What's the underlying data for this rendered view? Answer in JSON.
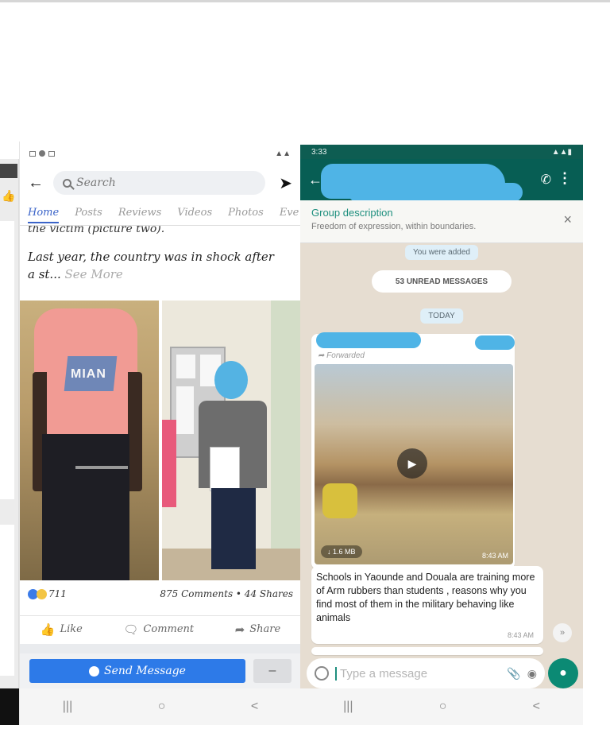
{
  "facebook": {
    "search_placeholder": "Search",
    "tabs": [
      "Home",
      "Posts",
      "Reviews",
      "Videos",
      "Photos",
      "Eve"
    ],
    "post_text_cut": "the victim (picture two).",
    "post_text": "Last year, the country was in shock after",
    "post_text_line2": "a st...",
    "see_more": "See More",
    "photo_print_text": "MIAN",
    "reaction_count": "711",
    "comments_shares": "875 Comments • 44 Shares",
    "actions": {
      "like": "Like",
      "comment": "Comment",
      "share": "Share"
    },
    "send_message": "Send Message",
    "more_button": "–"
  },
  "whatsapp": {
    "status_time": "3:33",
    "group_description_title": "Group description",
    "group_description_text": "Freedom of expression, within boundaries.",
    "you_were_added": "You were added",
    "unread_label": "53 UNREAD MESSAGES",
    "today_label": "TODAY",
    "forwarded_label": "Forwarded",
    "video_size": "1.6 MB",
    "video_time": "8:43 AM",
    "message_text": "Schools in Yaounde and Douala are training more of Arm rubbers than students , reasons why you find most of them in the military behaving like animals",
    "message_time": "8:43 AM",
    "input_placeholder": "Type a message"
  },
  "colors": {
    "whatsapp_green": "#075e54",
    "facebook_blue": "#2d7ae8",
    "redaction_blue": "#4fb4e6"
  }
}
